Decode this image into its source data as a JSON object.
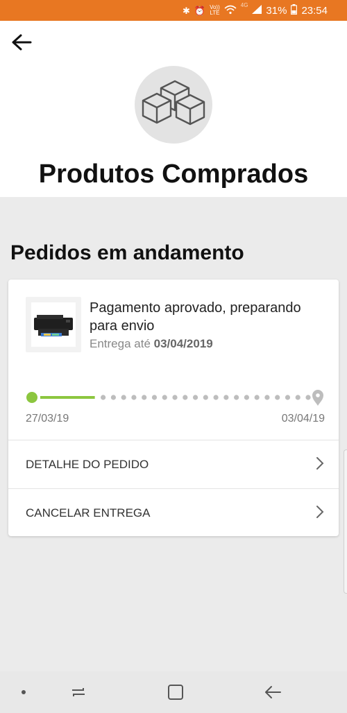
{
  "status_bar": {
    "battery_percent": "31%",
    "time": "23:54",
    "volte_top": "Vo))",
    "volte_bottom": "LTE",
    "network": "4G",
    "color": "#e87722"
  },
  "header": {
    "back_icon": "arrow-left-icon",
    "hero_icon": "boxes-icon",
    "title": "Produtos Comprados"
  },
  "orders_section": {
    "title": "Pedidos em andamento"
  },
  "order": {
    "product_image": "printer-icon",
    "status": "Pagamento aprovado, preparando para envio",
    "delivery_prefix": "Entrega até",
    "delivery_date": "03/04/2019",
    "tracker": {
      "progress": 0.22,
      "start_date": "27/03/19",
      "end_date": "03/04/19",
      "active_color": "#8cc63f",
      "inactive_color": "#bdbdbd"
    },
    "actions": [
      {
        "label": "DETALHE DO PEDIDO",
        "icon": "chevron-right-icon"
      },
      {
        "label": "CANCELAR ENTREGA",
        "icon": "chevron-right-icon"
      }
    ]
  },
  "nav_bar": {
    "items": [
      "dot-icon",
      "recent-apps-icon",
      "home-icon",
      "back-icon"
    ]
  }
}
